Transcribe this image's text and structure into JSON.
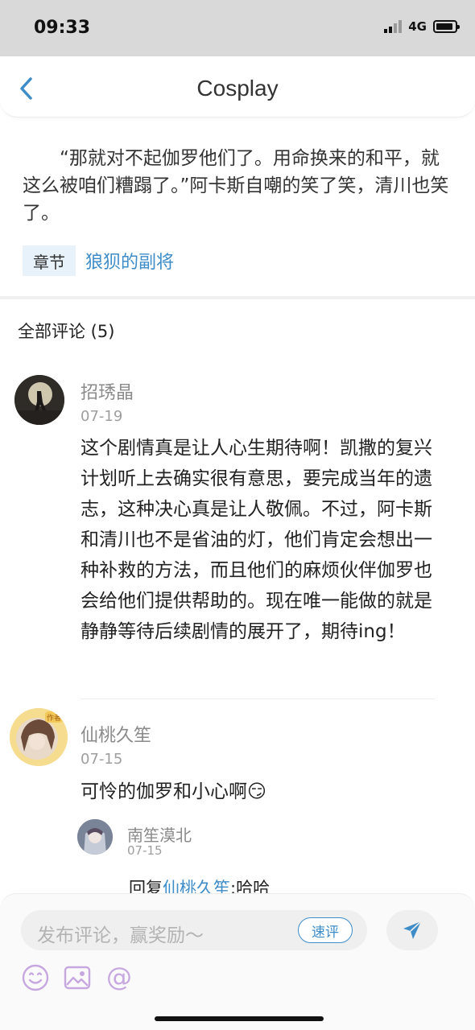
{
  "status": {
    "time": "09:33",
    "network": "4G"
  },
  "nav": {
    "title": "Cosplay"
  },
  "post": {
    "quote": "“那就对不起伽罗他们了。用命换来的和平，就这么被咱们糟蹋了。”阿卡斯自嘲的笑了笑，清川也笑了。",
    "chapter_tag": "章节",
    "chapter_name": "狼狈的副将"
  },
  "comments_heading": "全部评论 (5)",
  "comments": [
    {
      "name": "招琇晶",
      "date": "07-19",
      "text": "这个剧情真是让人心生期待啊！凯撒的复兴计划听上去确实很有意思，要完成当年的遗志，这种决心真是让人敬佩。不过，阿卡斯和清川也不是省油的灯，他们肯定会想出一种补救的方法，而且他们的麻烦伙伴伽罗也会给他们提供帮助的。现在唯一能做的就是静静等待后续剧情的展开了，期待ing！"
    },
    {
      "name": "仙桃久笙",
      "badge": "作者",
      "date": "07-15",
      "text": "可怜的伽罗和小心啊",
      "emoji": "😏",
      "replies": [
        {
          "name": "南笙漠北",
          "date": "07-15",
          "prefix": "回复",
          "target": "仙桃久笙",
          "text": ":哈哈"
        }
      ]
    }
  ],
  "input": {
    "placeholder": "发布评论，赢奖励～",
    "quick_review": "速评"
  },
  "tools": [
    "smile-icon",
    "image-icon",
    "at-icon"
  ],
  "colors": {
    "accent": "#3e8cc8",
    "tag_bg": "#e7f2fb",
    "toolbar_icon": "#c7a7e0"
  }
}
